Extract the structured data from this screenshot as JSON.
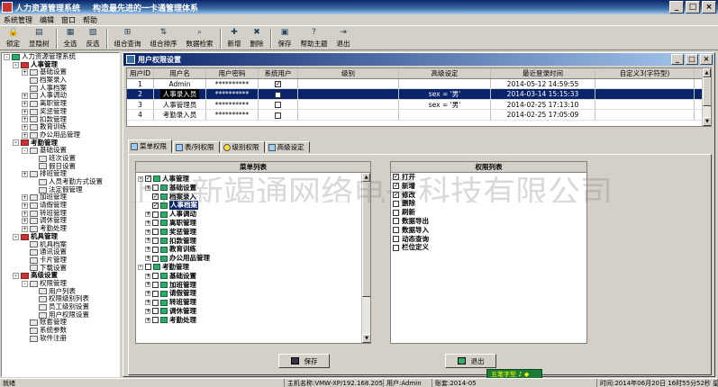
{
  "app": {
    "title": "人力资源管理系统",
    "slogan": "构造最先进的一卡通管理体系",
    "window_buttons": [
      "_",
      "□",
      "×"
    ]
  },
  "menu": [
    "系统管理",
    "编辑",
    "窗口",
    "帮助"
  ],
  "toolbar": [
    {
      "label": "锁定",
      "icon": "lock-icon",
      "glyph": "🔒"
    },
    {
      "label": "显隐树",
      "icon": "tree-icon",
      "glyph": "▤"
    },
    {
      "label": "全选",
      "icon": "select-all-icon",
      "glyph": "▦"
    },
    {
      "label": "反选",
      "icon": "invert-icon",
      "glyph": "▧"
    },
    {
      "label": "组合查询",
      "icon": "query-icon",
      "glyph": "⊞"
    },
    {
      "label": "组合排序",
      "icon": "sort-icon",
      "glyph": "⇅"
    },
    {
      "label": "数据检索",
      "icon": "search-icon",
      "glyph": "⌕"
    },
    {
      "label": "新增",
      "icon": "add-icon",
      "glyph": "✚"
    },
    {
      "label": "删除",
      "icon": "delete-icon",
      "glyph": "✖"
    },
    {
      "label": "保存",
      "icon": "save-icon",
      "glyph": "▣"
    },
    {
      "label": "帮助主题",
      "icon": "help-icon",
      "glyph": "?"
    },
    {
      "label": "退出",
      "icon": "exit-icon",
      "glyph": "⇥"
    }
  ],
  "tree": [
    {
      "label": "人力资源管理系统",
      "level": 0,
      "type": "root",
      "exp": "-"
    },
    {
      "label": "人事管理",
      "level": 1,
      "type": "grp",
      "exp": "-",
      "bold": true
    },
    {
      "label": "基础设置",
      "level": 2,
      "type": "leaf",
      "exp": "+"
    },
    {
      "label": "档案录入",
      "level": 2,
      "type": "leaf",
      "exp": ""
    },
    {
      "label": "人事档案",
      "level": 2,
      "type": "leaf",
      "exp": ""
    },
    {
      "label": "人事调动",
      "level": 2,
      "type": "leaf",
      "exp": "+"
    },
    {
      "label": "离职管理",
      "level": 2,
      "type": "leaf",
      "exp": "+"
    },
    {
      "label": "奖惩管理",
      "level": 2,
      "type": "leaf",
      "exp": "+"
    },
    {
      "label": "扣款管理",
      "level": 2,
      "type": "leaf",
      "exp": "+"
    },
    {
      "label": "教育训练",
      "level": 2,
      "type": "leaf",
      "exp": "+"
    },
    {
      "label": "办公用品管理",
      "level": 2,
      "type": "leaf",
      "exp": "+"
    },
    {
      "label": "考勤管理",
      "level": 1,
      "type": "grp",
      "exp": "-",
      "bold": true
    },
    {
      "label": "基础设置",
      "level": 2,
      "type": "leaf",
      "exp": "-"
    },
    {
      "label": "班次设置",
      "level": 3,
      "type": "leaf",
      "exp": ""
    },
    {
      "label": "假日设置",
      "level": 3,
      "type": "leaf",
      "exp": ""
    },
    {
      "label": "排班管理",
      "level": 2,
      "type": "leaf",
      "exp": "+"
    },
    {
      "label": "人员考勤方式设置",
      "level": 3,
      "type": "leaf",
      "exp": ""
    },
    {
      "label": "法定假管理",
      "level": 3,
      "type": "leaf",
      "exp": ""
    },
    {
      "label": "加班管理",
      "level": 2,
      "type": "leaf",
      "exp": "+"
    },
    {
      "label": "请假管理",
      "level": 2,
      "type": "leaf",
      "exp": "+"
    },
    {
      "label": "转班管理",
      "level": 2,
      "type": "leaf",
      "exp": "+"
    },
    {
      "label": "调休管理",
      "level": 2,
      "type": "leaf",
      "exp": "+"
    },
    {
      "label": "考勤处理",
      "level": 2,
      "type": "leaf",
      "exp": "+"
    },
    {
      "label": "机具管理",
      "level": 1,
      "type": "grp",
      "exp": "-",
      "bold": true
    },
    {
      "label": "机具档案",
      "level": 2,
      "type": "leaf",
      "exp": ""
    },
    {
      "label": "通讯设置",
      "level": 2,
      "type": "leaf",
      "exp": ""
    },
    {
      "label": "卡片管理",
      "level": 2,
      "type": "leaf",
      "exp": ""
    },
    {
      "label": "下载设置",
      "level": 2,
      "type": "leaf",
      "exp": ""
    },
    {
      "label": "高级设置",
      "level": 1,
      "type": "grp",
      "exp": "-",
      "bold": true
    },
    {
      "label": "权限管理",
      "level": 2,
      "type": "leaf",
      "exp": "-"
    },
    {
      "label": "用户列表",
      "level": 3,
      "type": "leaf",
      "exp": ""
    },
    {
      "label": "权限级别列表",
      "level": 3,
      "type": "leaf",
      "exp": ""
    },
    {
      "label": "员工级别设置",
      "level": 3,
      "type": "leaf",
      "exp": ""
    },
    {
      "label": "用户权限设置",
      "level": 3,
      "type": "leaf",
      "exp": ""
    },
    {
      "label": "账套管理",
      "level": 2,
      "type": "leaf",
      "exp": ""
    },
    {
      "label": "系统参数",
      "level": 2,
      "type": "leaf",
      "exp": ""
    },
    {
      "label": "软件注册",
      "level": 2,
      "type": "leaf",
      "exp": ""
    }
  ],
  "inner_window": {
    "title": "用户权限设置",
    "buttons": [
      "_",
      "□",
      "×"
    ]
  },
  "grid": {
    "columns": [
      "用户ID",
      "用户名",
      "用户密码",
      "系统用户",
      "级别",
      "高级设定",
      "最近登录时间",
      "自定义3(字符型)"
    ],
    "rows": [
      {
        "id": "1",
        "name": "Admin",
        "pwd": "**********",
        "sys": "✓",
        "level": "",
        "adv": "",
        "time": "2014-05-12 14:59:55",
        "custom": "",
        "selected": false
      },
      {
        "id": "2",
        "name": "人事录入员",
        "pwd": "**********",
        "sys": "",
        "level": "",
        "adv": "sex = '男'",
        "time": "2014-03-14 15:15:33",
        "custom": "",
        "selected": true
      },
      {
        "id": "3",
        "name": "人事管理员",
        "pwd": "**********",
        "sys": "",
        "level": "",
        "adv": "sex = '男'",
        "time": "2014-02-25 17:13:10",
        "custom": "",
        "selected": false
      },
      {
        "id": "4",
        "name": "考勤录入员",
        "pwd": "**********",
        "sys": "",
        "level": "",
        "adv": "",
        "time": "2014-02-25 17:05:09",
        "custom": "",
        "selected": false
      }
    ]
  },
  "tabs": [
    "菜单权限",
    "表/列权限",
    "级别权限",
    "高级设定"
  ],
  "menu_list": {
    "header": "菜单列表",
    "items": [
      {
        "label": "人事管理",
        "level": 0,
        "exp": "-",
        "check": "✓",
        "hl": false
      },
      {
        "label": "基础设置",
        "level": 1,
        "exp": "+",
        "check": "",
        "hl": false
      },
      {
        "label": "档案录入",
        "level": 1,
        "exp": "",
        "check": "✓",
        "hl": false
      },
      {
        "label": "人事档案",
        "level": 1,
        "exp": "",
        "check": "✓",
        "hl": true
      },
      {
        "label": "人事调动",
        "level": 1,
        "exp": "+",
        "check": "",
        "hl": false
      },
      {
        "label": "离职管理",
        "level": 1,
        "exp": "+",
        "check": "",
        "hl": false
      },
      {
        "label": "奖惩管理",
        "level": 1,
        "exp": "+",
        "check": "",
        "hl": false
      },
      {
        "label": "扣款管理",
        "level": 1,
        "exp": "+",
        "check": "",
        "hl": false
      },
      {
        "label": "教育训练",
        "level": 1,
        "exp": "+",
        "check": "",
        "hl": false
      },
      {
        "label": "办公用品管理",
        "level": 1,
        "exp": "+",
        "check": "",
        "hl": false
      },
      {
        "label": "考勤管理",
        "level": 0,
        "exp": "-",
        "check": "",
        "hl": false
      },
      {
        "label": "基础设置",
        "level": 1,
        "exp": "+",
        "check": "",
        "hl": false
      },
      {
        "label": "加班管理",
        "level": 1,
        "exp": "+",
        "check": "",
        "hl": false
      },
      {
        "label": "请假管理",
        "level": 1,
        "exp": "+",
        "check": "",
        "hl": false
      },
      {
        "label": "转班管理",
        "level": 1,
        "exp": "+",
        "check": "",
        "hl": false
      },
      {
        "label": "调休管理",
        "level": 1,
        "exp": "+",
        "check": "",
        "hl": false
      },
      {
        "label": "考勤处理",
        "level": 1,
        "exp": "+",
        "check": "",
        "hl": false
      }
    ]
  },
  "permission_list": {
    "header": "权限列表",
    "items": [
      {
        "label": "打开",
        "check": "✓"
      },
      {
        "label": "新增",
        "check": "✓"
      },
      {
        "label": "修改",
        "check": "✓"
      },
      {
        "label": "删除",
        "check": ""
      },
      {
        "label": "刷新",
        "check": ""
      },
      {
        "label": "数据导出",
        "check": ""
      },
      {
        "label": "数据导入",
        "check": ""
      },
      {
        "label": "动态查询",
        "check": ""
      },
      {
        "label": "栏位定义",
        "check": ""
      }
    ]
  },
  "buttons": {
    "save": "保存",
    "exit": "退出"
  },
  "watermark": "上海新竭通网络电子科技有限公司",
  "ime": "五笔字型 ♪ ◆",
  "statusbar": {
    "ready": "就绪",
    "host": "主机名称:VMW-XP/192.168.205.132",
    "user": "用户:Admin",
    "account": "账套:2014-05",
    "time": "时间:2014年06月20日 16时55分52秒 星期五"
  }
}
